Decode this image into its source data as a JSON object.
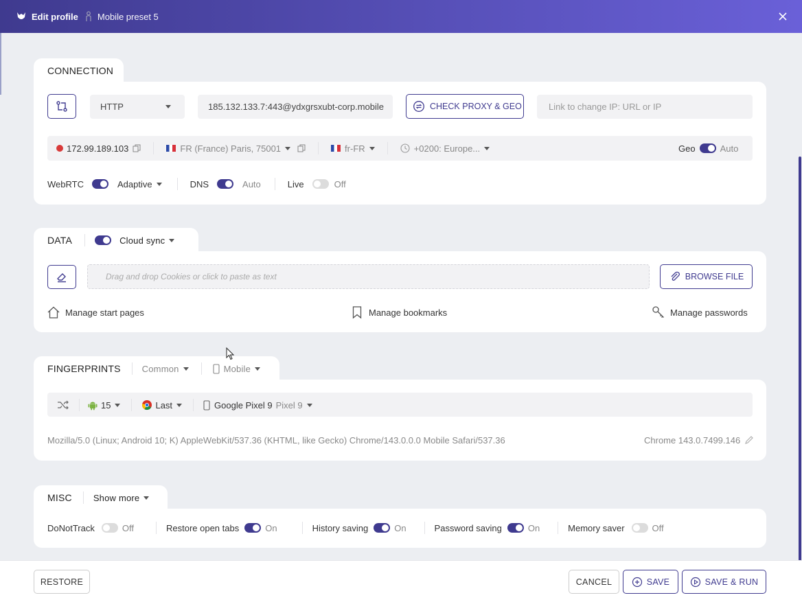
{
  "window": {
    "title": "Edit profile",
    "preset": "Mobile preset 5",
    "colors": {
      "accent": "#3f3a8f",
      "titlebar_start": "#3f3a8f",
      "titlebar_end": "#6a60d8"
    }
  },
  "connection": {
    "header": "CONNECTION",
    "proxy_type": "HTTP",
    "proxy_value": "185.132.133.7:443@ydxgrsxubt-corp.mobile",
    "check_button": "CHECK PROXY & GEO",
    "change_ip_placeholder": "Link to change IP: URL or IP",
    "ip": "172.99.189.103",
    "location": "FR (France) Paris, 75001",
    "language": "fr-FR",
    "timezone": "+0200: Europe...",
    "geo_label": "Geo",
    "geo_value": "Auto",
    "webrtc_label": "WebRTC",
    "webrtc_value": "Adaptive",
    "dns_label": "DNS",
    "dns_value": "Auto",
    "live_label": "Live",
    "live_value": "Off"
  },
  "data": {
    "header": "DATA",
    "cloud_sync": "Cloud sync",
    "drop_placeholder": "Drag and drop Cookies or click to paste as text",
    "browse_button": "BROWSE FILE",
    "manage_start_pages": "Manage start pages",
    "manage_bookmarks": "Manage bookmarks",
    "manage_passwords": "Manage passwords"
  },
  "fingerprints": {
    "header": "FINGERPRINTS",
    "profile_type": "Common",
    "device_type": "Mobile",
    "android_version": "15",
    "browser_version": "Last",
    "device_name": "Google Pixel 9",
    "device_model": "Pixel 9",
    "user_agent": "Mozilla/5.0 (Linux; Android 10; K) AppleWebKit/537.36 (KHTML, like Gecko) Chrome/143.0.0.0 Mobile Safari/537.36",
    "chrome_version": "Chrome 143.0.7499.146"
  },
  "misc": {
    "header": "MISC",
    "show_more": "Show more",
    "items": [
      {
        "label": "DoNotTrack",
        "value": "Off"
      },
      {
        "label": "Restore open tabs",
        "value": "On"
      },
      {
        "label": "History saving",
        "value": "On"
      },
      {
        "label": "Password saving",
        "value": "On"
      },
      {
        "label": "Memory saver",
        "value": "Off"
      }
    ]
  },
  "footer": {
    "restore": "RESTORE",
    "cancel": "CANCEL",
    "save": "SAVE",
    "save_run": "SAVE & RUN"
  }
}
